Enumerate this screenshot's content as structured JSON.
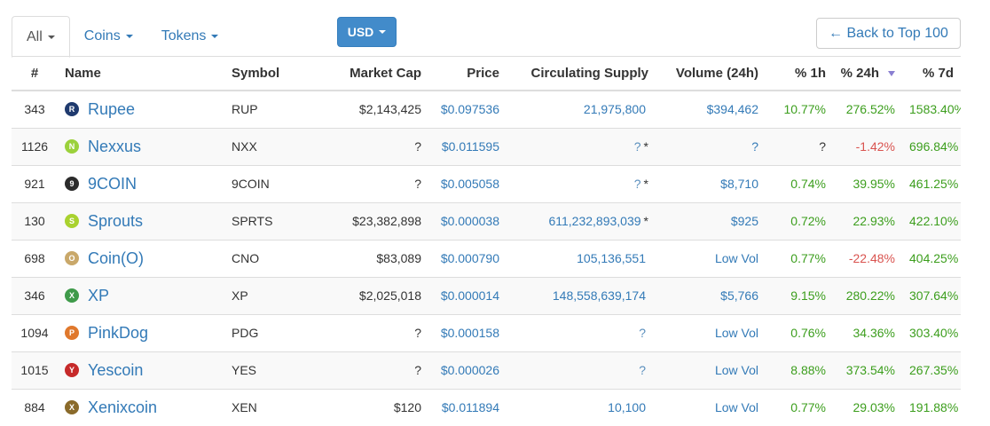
{
  "tabs": [
    {
      "label": "All",
      "active": true
    },
    {
      "label": "Coins",
      "active": false
    },
    {
      "label": "Tokens",
      "active": false
    }
  ],
  "currency_button": "USD",
  "back_button": "← Back to Top 100",
  "columns": [
    "#",
    "Name",
    "Symbol",
    "Market Cap",
    "Price",
    "Circulating Supply",
    "Volume (24h)",
    "% 1h",
    "% 24h",
    "% 7d"
  ],
  "sorted_column": "% 24h",
  "colors": {
    "link": "#337ab7",
    "positive": "#3c9e1d",
    "negative": "#d9534f",
    "button": "#428bca"
  },
  "rows": [
    {
      "rank": "343",
      "name": "Rupee",
      "icon": "rupee-icon",
      "symbol": "RUP",
      "market_cap": "$2,143,425",
      "price": "$0.097536",
      "supply": "21,975,800",
      "supply_star": "",
      "volume": "$394,462",
      "h1": "10.77%",
      "h24": "276.52%",
      "d7": "1583.40%"
    },
    {
      "rank": "1126",
      "name": "Nexxus",
      "icon": "nexxus-icon",
      "symbol": "NXX",
      "market_cap": "?",
      "price": "$0.011595",
      "supply": "?",
      "supply_star": "*",
      "volume": "?",
      "h1": "?",
      "h24": "-1.42%",
      "d7": "696.84%"
    },
    {
      "rank": "921",
      "name": "9COIN",
      "icon": "9coin-icon",
      "symbol": "9COIN",
      "market_cap": "?",
      "price": "$0.005058",
      "supply": "?",
      "supply_star": "*",
      "volume": "$8,710",
      "h1": "0.74%",
      "h24": "39.95%",
      "d7": "461.25%"
    },
    {
      "rank": "130",
      "name": "Sprouts",
      "icon": "sprouts-icon",
      "symbol": "SPRTS",
      "market_cap": "$23,382,898",
      "price": "$0.000038",
      "supply": "611,232,893,039",
      "supply_star": "*",
      "volume": "$925",
      "h1": "0.72%",
      "h24": "22.93%",
      "d7": "422.10%"
    },
    {
      "rank": "698",
      "name": "Coin(O)",
      "icon": "coin-o-icon",
      "symbol": "CNO",
      "market_cap": "$83,089",
      "price": "$0.000790",
      "supply": "105,136,551",
      "supply_star": "",
      "volume": "Low Vol",
      "h1": "0.77%",
      "h24": "-22.48%",
      "d7": "404.25%"
    },
    {
      "rank": "346",
      "name": "XP",
      "icon": "xp-icon",
      "symbol": "XP",
      "market_cap": "$2,025,018",
      "price": "$0.000014",
      "supply": "148,558,639,174",
      "supply_star": "",
      "volume": "$5,766",
      "h1": "9.15%",
      "h24": "280.22%",
      "d7": "307.64%"
    },
    {
      "rank": "1094",
      "name": "PinkDog",
      "icon": "pinkdog-icon",
      "symbol": "PDG",
      "market_cap": "?",
      "price": "$0.000158",
      "supply": "?",
      "supply_star": "",
      "volume": "Low Vol",
      "h1": "0.76%",
      "h24": "34.36%",
      "d7": "303.40%"
    },
    {
      "rank": "1015",
      "name": "Yescoin",
      "icon": "yescoin-icon",
      "symbol": "YES",
      "market_cap": "?",
      "price": "$0.000026",
      "supply": "?",
      "supply_star": "",
      "volume": "Low Vol",
      "h1": "8.88%",
      "h24": "373.54%",
      "d7": "267.35%"
    },
    {
      "rank": "884",
      "name": "Xenixcoin",
      "icon": "xenixcoin-icon",
      "symbol": "XEN",
      "market_cap": "$120",
      "price": "$0.011894",
      "supply": "10,100",
      "supply_star": "",
      "volume": "Low Vol",
      "h1": "0.77%",
      "h24": "29.03%",
      "d7": "191.88%"
    }
  ]
}
